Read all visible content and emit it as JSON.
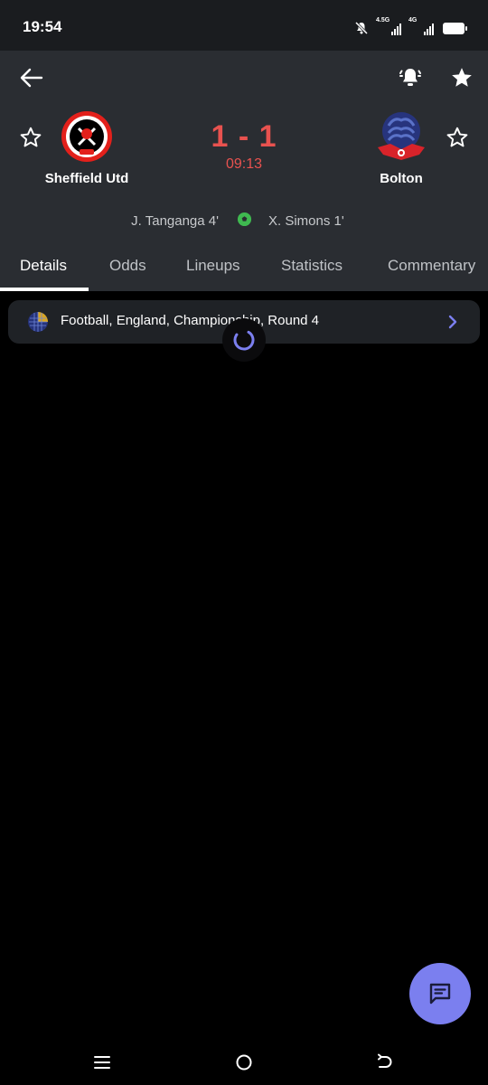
{
  "status_bar": {
    "time": "19:54",
    "signal_1_label": "4.5G",
    "signal_2_label": "4G"
  },
  "match": {
    "home_team": "Sheffield Utd",
    "away_team": "Bolton",
    "score": "1 - 1",
    "clock": "09:13",
    "home_scorer": "J. Tanganga 4'",
    "away_scorer": "X. Simons 1'"
  },
  "tabs": [
    {
      "label": "Details"
    },
    {
      "label": "Odds"
    },
    {
      "label": "Lineups"
    },
    {
      "label": "Statistics"
    },
    {
      "label": "Commentary"
    }
  ],
  "tournament": {
    "label": "Football, England, Championship, Round 4"
  },
  "colors": {
    "score_red": "#e8524f",
    "header_bg": "#2a2d32",
    "accent": "#7b7fef"
  },
  "icons": [
    "back-arrow-icon",
    "bell-icon",
    "star-filled-icon",
    "star-outline-icon",
    "soccer-ball-icon",
    "chevron-right-icon",
    "chat-icon"
  ]
}
